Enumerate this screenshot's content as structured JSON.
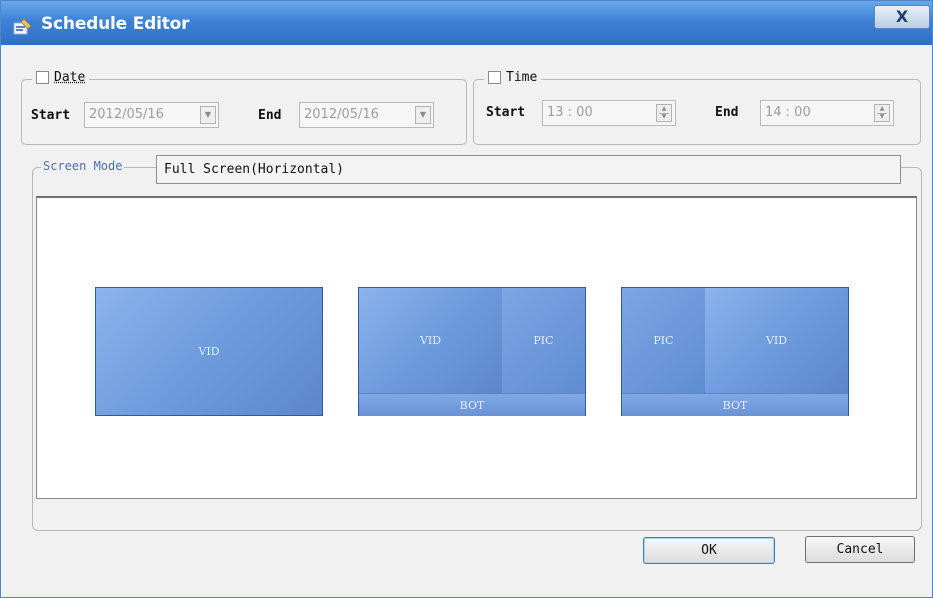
{
  "window": {
    "title": "Schedule Editor",
    "close_label": "X"
  },
  "date_group": {
    "label": "Date",
    "checked": false,
    "start_label": "Start",
    "start_value": "2012/05/16",
    "end_label": "End",
    "end_value": "2012/05/16"
  },
  "time_group": {
    "label": "Time",
    "checked": false,
    "start_label": "Start",
    "start_value": "13 : 00",
    "end_label": "End",
    "end_value": "14 : 00"
  },
  "screen_mode": {
    "label": "Screen Mode",
    "value": "Full Screen(Horizontal)",
    "layouts": [
      {
        "panes": [
          "VID"
        ]
      },
      {
        "panes": [
          "VID",
          "PIC",
          "BOT"
        ]
      },
      {
        "panes": [
          "PIC",
          "VID",
          "BOT"
        ]
      }
    ]
  },
  "buttons": {
    "ok": "OK",
    "cancel": "Cancel"
  },
  "colors": {
    "titlebar": "#3d82d6",
    "layout_fill": "#6e9ad8",
    "layout_border": "#335a9c"
  },
  "icons": [
    "schedule-editor-icon",
    "close-icon",
    "dropdown-arrow-icon",
    "spin-arrows-icon"
  ]
}
